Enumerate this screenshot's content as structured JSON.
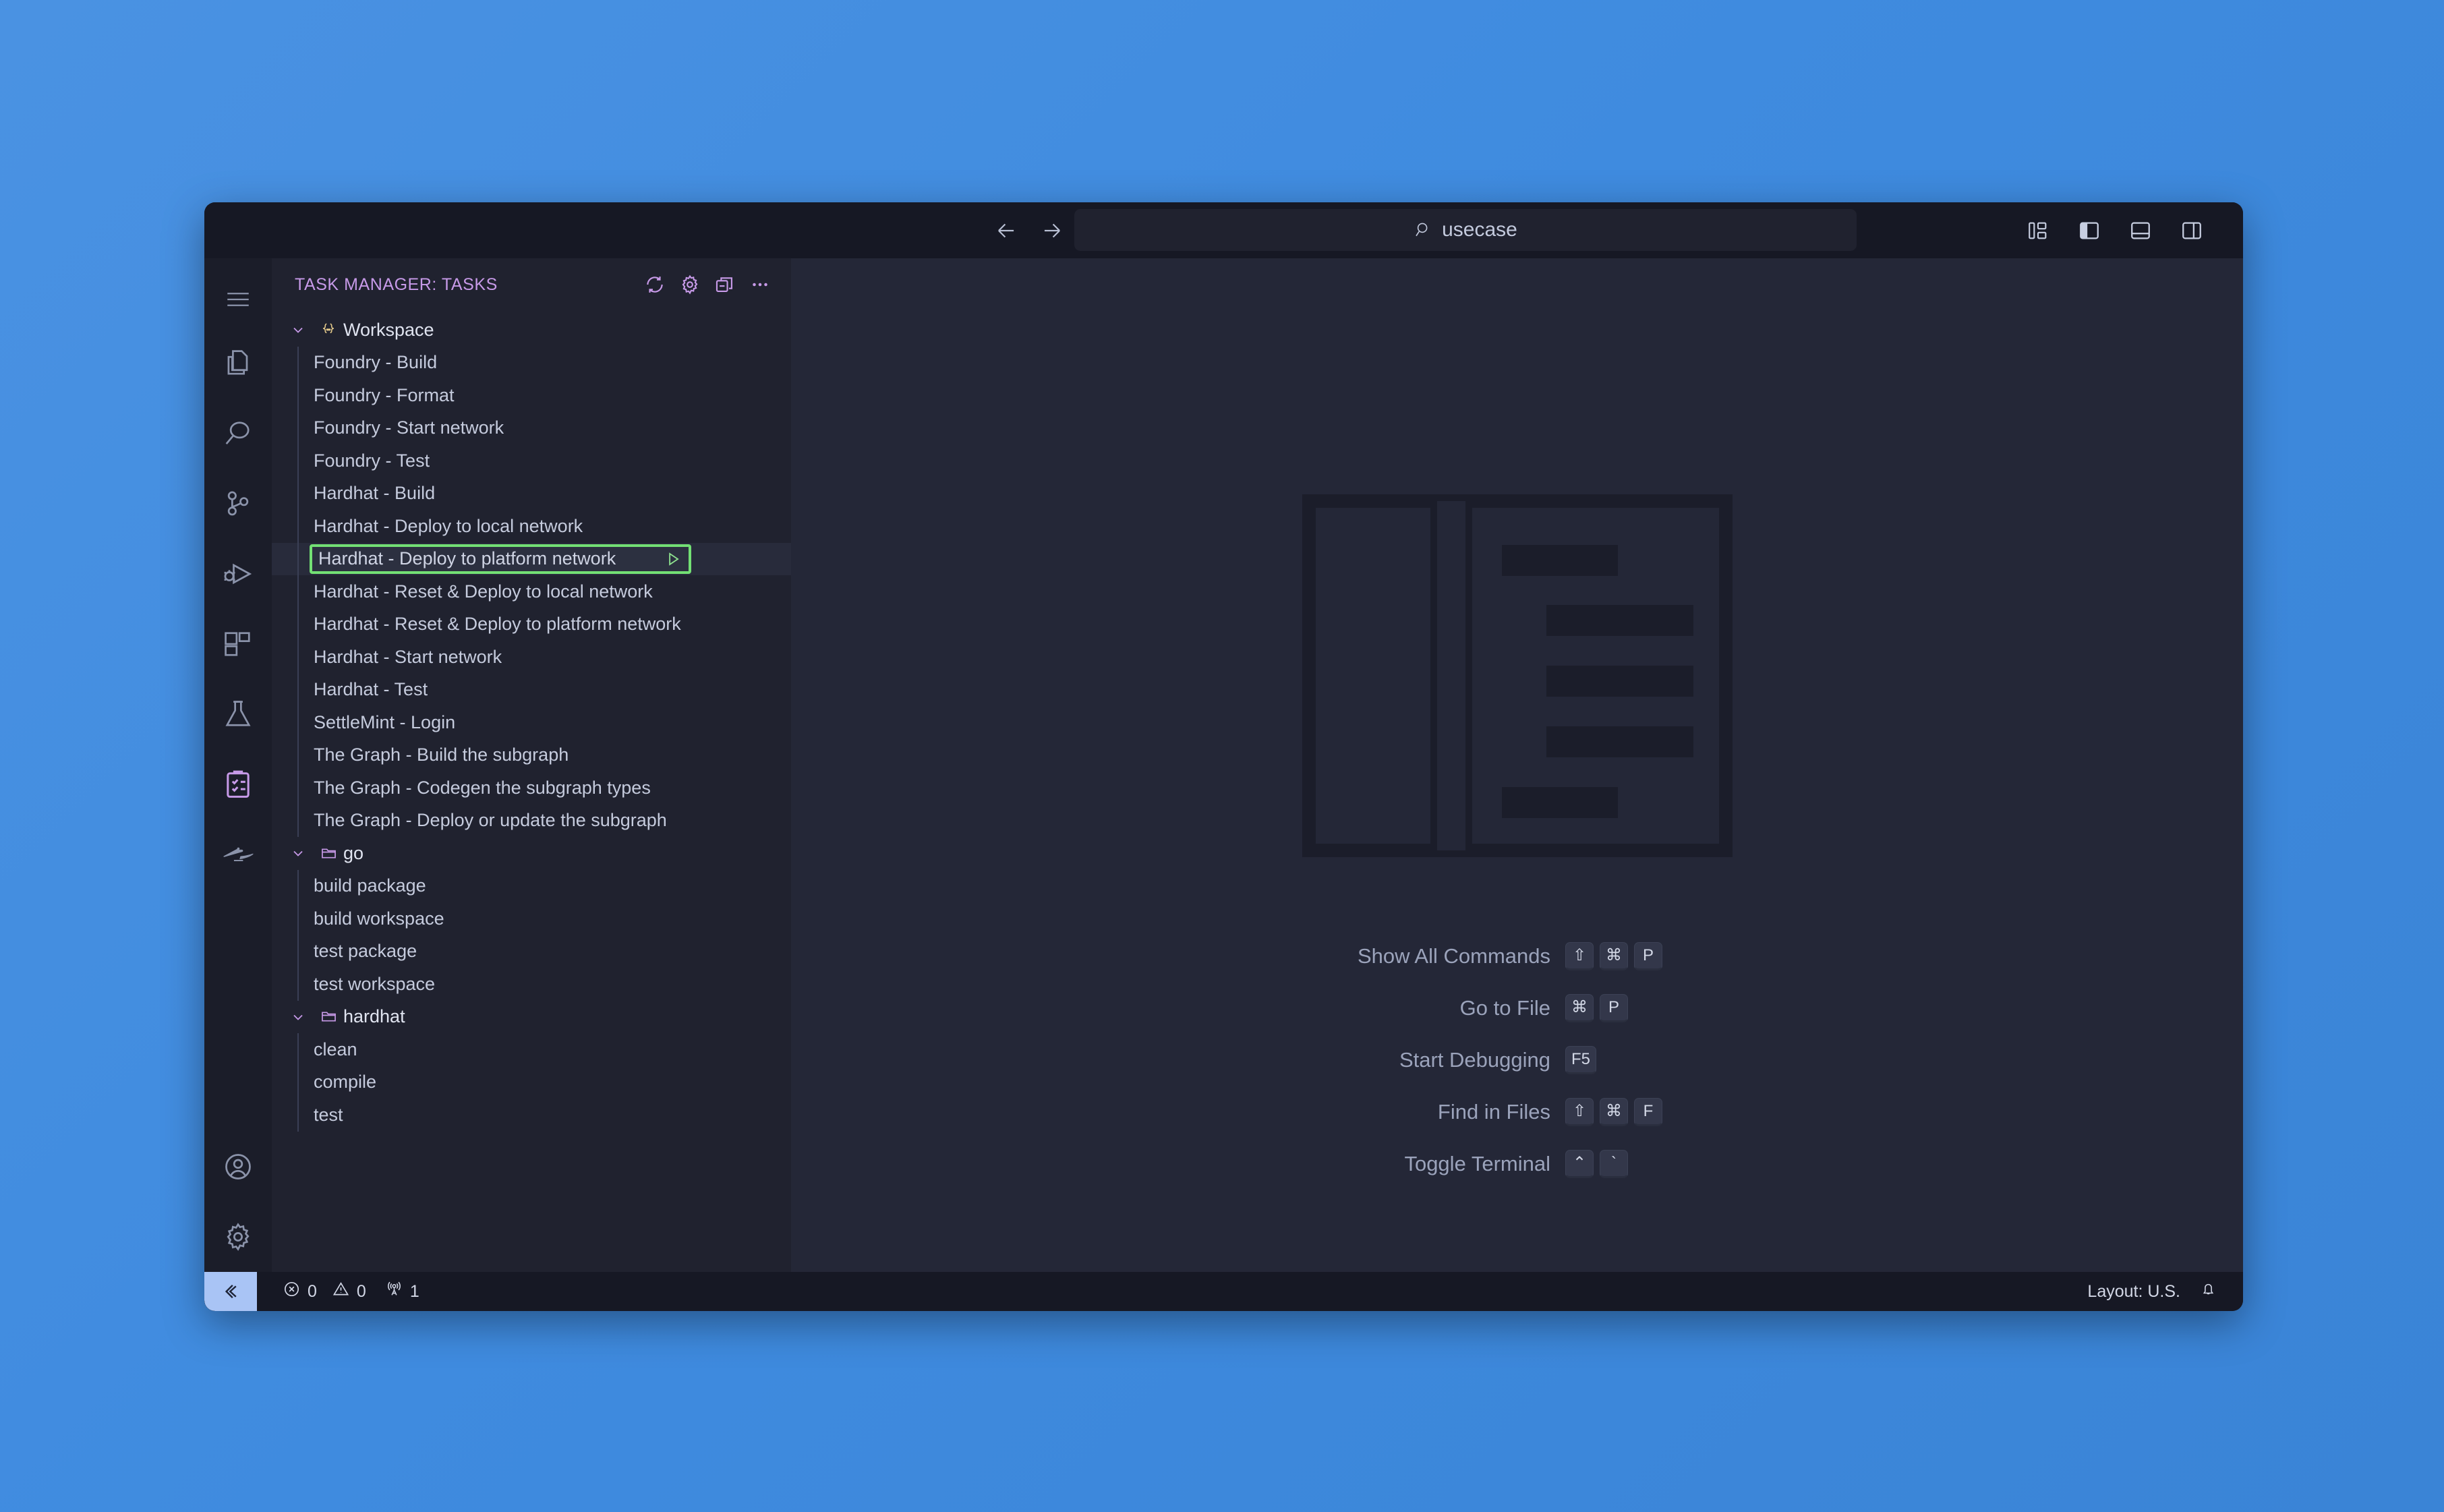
{
  "titlebar": {
    "back_icon": "arrow-left-icon",
    "forward_icon": "arrow-right-icon",
    "quick_input_value": "usecase",
    "quick_input_icon": "search-icon",
    "layout_buttons": [
      {
        "name": "customize-layout-icon",
        "label": "Customize Layout"
      },
      {
        "name": "toggle-primary-sidebar-icon",
        "label": "Toggle Primary Side Bar"
      },
      {
        "name": "toggle-panel-icon",
        "label": "Toggle Panel"
      },
      {
        "name": "toggle-secondary-sidebar-icon",
        "label": "Toggle Secondary Side Bar"
      }
    ]
  },
  "activitybar": {
    "menu": {
      "label": "Menu",
      "icon": "hamburger-menu-icon"
    },
    "items": [
      {
        "label": "Explorer",
        "icon": "files-icon",
        "active": false
      },
      {
        "label": "Search",
        "icon": "search-icon",
        "active": false
      },
      {
        "label": "Source Control",
        "icon": "source-control-icon",
        "active": false
      },
      {
        "label": "Run and Debug",
        "icon": "run-and-debug-icon",
        "active": false
      },
      {
        "label": "Extensions",
        "icon": "extensions-icon",
        "active": false
      },
      {
        "label": "Testing",
        "icon": "beaker-icon",
        "active": false
      },
      {
        "label": "Task Manager",
        "icon": "checklist-icon",
        "active": true
      },
      {
        "label": "Codeium",
        "icon": "lamp-icon",
        "active": false
      }
    ],
    "bottom_items": [
      {
        "label": "Accounts",
        "icon": "account-icon"
      },
      {
        "label": "Manage",
        "icon": "gear-icon"
      }
    ]
  },
  "sidebar": {
    "title": "TASK MANAGER: TASKS",
    "actions": [
      {
        "label": "Refresh",
        "icon": "refresh-icon"
      },
      {
        "label": "Settings",
        "icon": "gear-icon"
      },
      {
        "label": "Collapse All",
        "icon": "collapse-all-icon"
      },
      {
        "label": "Views and More Actions",
        "icon": "ellipsis-icon"
      }
    ],
    "groups": [
      {
        "label": "Workspace",
        "icon": "braces-icon",
        "expanded": true,
        "tasks": [
          {
            "label": "Foundry - Build"
          },
          {
            "label": "Foundry - Format"
          },
          {
            "label": "Foundry - Start network"
          },
          {
            "label": "Foundry - Test"
          },
          {
            "label": "Hardhat - Build"
          },
          {
            "label": "Hardhat - Deploy to local network"
          },
          {
            "label": "Hardhat - Deploy to platform network",
            "selected": true,
            "run_icon": "play-icon"
          },
          {
            "label": "Hardhat - Reset & Deploy to local network"
          },
          {
            "label": "Hardhat - Reset & Deploy to platform network"
          },
          {
            "label": "Hardhat - Start network"
          },
          {
            "label": "Hardhat - Test"
          },
          {
            "label": "SettleMint - Login"
          },
          {
            "label": "The Graph - Build the subgraph"
          },
          {
            "label": "The Graph - Codegen the subgraph types"
          },
          {
            "label": "The Graph - Deploy or update the subgraph"
          }
        ]
      },
      {
        "label": "go",
        "icon": "folder-icon",
        "expanded": true,
        "tasks": [
          {
            "label": "build package"
          },
          {
            "label": "build workspace"
          },
          {
            "label": "test package"
          },
          {
            "label": "test workspace"
          }
        ]
      },
      {
        "label": "hardhat",
        "icon": "folder-icon",
        "expanded": true,
        "tasks": [
          {
            "label": "clean"
          },
          {
            "label": "compile"
          },
          {
            "label": "test"
          }
        ]
      }
    ]
  },
  "editor": {
    "watermark_icon": "empty-editor-layout-graphic",
    "shortcuts": [
      {
        "label": "Show All Commands",
        "keys": [
          "⇧",
          "⌘",
          "P"
        ]
      },
      {
        "label": "Go to File",
        "keys": [
          "⌘",
          "P"
        ]
      },
      {
        "label": "Start Debugging",
        "keys": [
          "F5"
        ]
      },
      {
        "label": "Find in Files",
        "keys": [
          "⇧",
          "⌘",
          "F"
        ]
      },
      {
        "label": "Toggle Terminal",
        "keys": [
          "⌃",
          "`"
        ]
      }
    ]
  },
  "statusbar": {
    "remote_icon": "remote-window-icon",
    "errors": "0",
    "warnings": "0",
    "ports": "1",
    "error_icon": "error-circle-icon",
    "warning_icon": "warning-triangle-icon",
    "ports_icon": "radio-tower-icon",
    "keyboard_layout": "Layout: U.S.",
    "bell_icon": "bell-icon"
  },
  "colors": {
    "accent_purple": "#c79ae8",
    "selection_green": "#73e074",
    "remote_blue": "#a9c4f5",
    "desktop_blue": "#3f8bdf"
  }
}
